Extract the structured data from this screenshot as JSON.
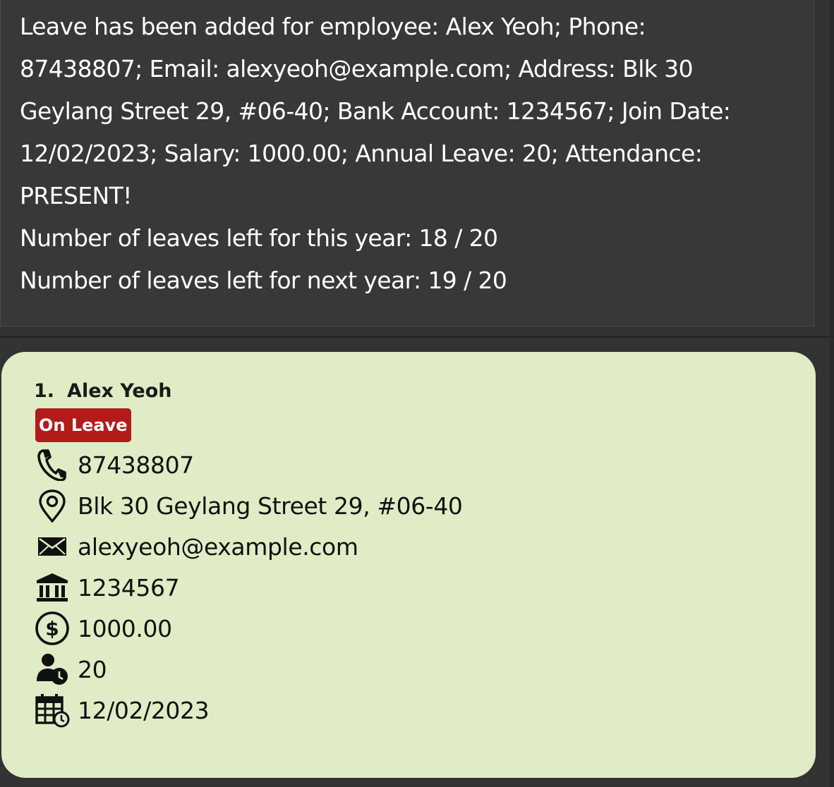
{
  "result": {
    "lines": [
      "Leave has been added for employee: Alex Yeoh; Phone:",
      "87438807; Email: alexyeoh@example.com; Address: Blk 30",
      "Geylang Street 29, #06-40; Bank Account: 1234567; Join Date:",
      "12/02/2023; Salary: 1000.00; Annual Leave: 20; Attendance:",
      "PRESENT!",
      "Number of leaves left for this year: 18 / 20",
      "Number of leaves left for next year: 19 / 20"
    ]
  },
  "employee_card": {
    "index": "1.",
    "name": "Alex Yeoh",
    "status_badge": "On Leave",
    "status_color": "#b31b1b",
    "card_color": "#e0ecc5",
    "fields": {
      "phone": "87438807",
      "address": "Blk 30 Geylang Street 29, #06-40",
      "email": "alexyeoh@example.com",
      "bank_account": "1234567",
      "salary": "1000.00",
      "annual_leave": "20",
      "join_date": "12/02/2023"
    },
    "icons": {
      "phone": "phone-icon",
      "address": "location-pin-icon",
      "email": "envelope-icon",
      "bank_account": "bank-icon",
      "salary": "dollar-circle-icon",
      "annual_leave": "person-clock-icon",
      "join_date": "calendar-clock-icon"
    }
  }
}
